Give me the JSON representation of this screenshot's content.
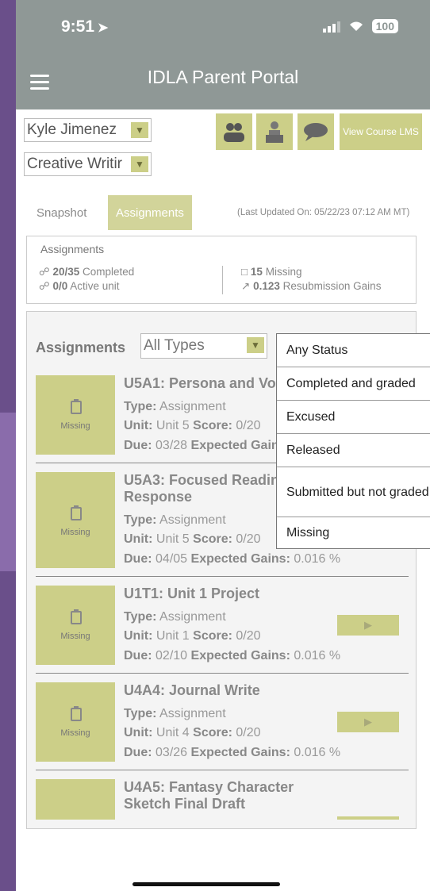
{
  "status": {
    "time": "9:51",
    "battery": "100"
  },
  "app": {
    "title": "IDLA Parent Portal"
  },
  "student_select": {
    "value": "Kyle Jimenez"
  },
  "course_select": {
    "value": "Creative Writir"
  },
  "toolbar": {
    "icons": [
      "people-icon",
      "teacher-icon",
      "chat-icon"
    ],
    "lms_label": "View Course LMS"
  },
  "tabs": [
    {
      "label": "Snapshot"
    },
    {
      "label": "Assignments",
      "active": true
    }
  ],
  "last_updated": "(Last Updated On: 05/22/23 07:12 AM MT)",
  "summary": {
    "title": "Assignments",
    "completed_value": "20/35",
    "completed_label": "Completed",
    "active_value": "0/0",
    "active_label": "Active unit",
    "missing_value": "15",
    "missing_label": "Missing",
    "gains_value": "0.123",
    "gains_label": "Resubmission Gains"
  },
  "filters": {
    "label": "Assignments",
    "type_value": "All Types",
    "status_options": [
      "Any Status",
      "Completed and graded",
      "Excused",
      "Released",
      "Submitted but not graded",
      "Missing"
    ]
  },
  "labels": {
    "type": "Type:",
    "unit": "Unit:",
    "score": "Score:",
    "due": "Due:",
    "gains": "Expected Gains:"
  },
  "assignments": [
    {
      "title": "U5A1:  Persona and Vo",
      "status": "Missing",
      "type": "Assignment",
      "unit": "Unit 5",
      "score": "0/20",
      "due": "03/28",
      "gains": "0.016 %"
    },
    {
      "title": "U5A3:  Focused Readin",
      "title2": "Response",
      "status": "Missing",
      "type": "Assignment",
      "unit": "Unit 5",
      "score": "0/20",
      "due": "04/05",
      "gains": "0.016 %"
    },
    {
      "title": "U1T1:  Unit 1 Project",
      "status": "Missing",
      "type": "Assignment",
      "unit": "Unit 1",
      "score": "0/20",
      "due": "02/10",
      "gains": "0.016 %"
    },
    {
      "title": "U4A4:  Journal Write",
      "status": "Missing",
      "type": "Assignment",
      "unit": "Unit 4",
      "score": "0/20",
      "due": "03/26",
      "gains": "0.016 %"
    },
    {
      "title": "U4A5:  Fantasy Character",
      "title2": "Sketch Final Draft"
    }
  ]
}
